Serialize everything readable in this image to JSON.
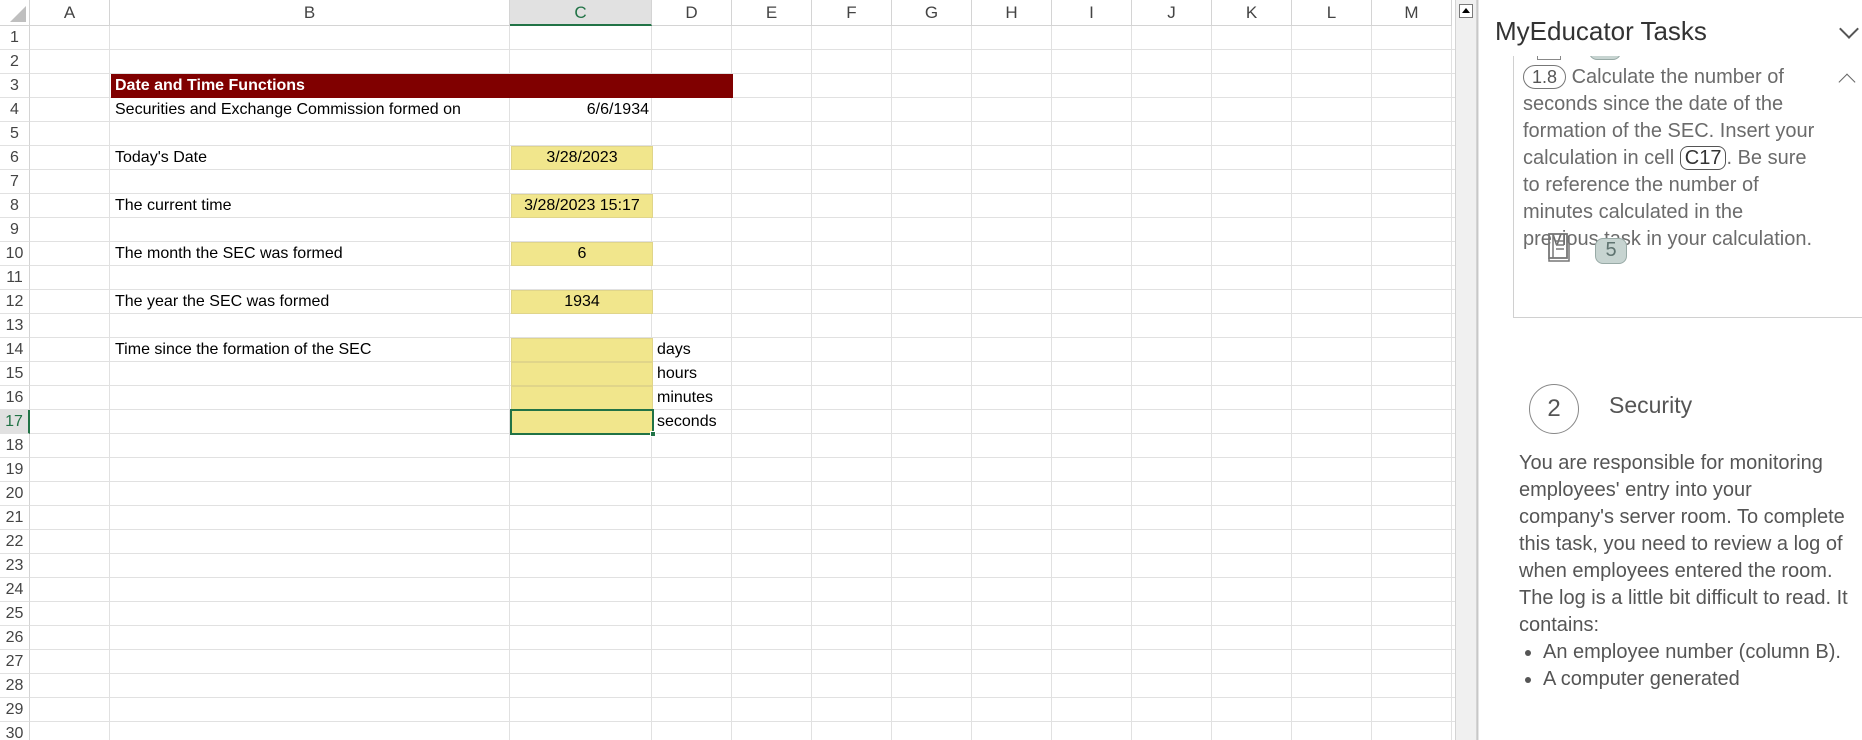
{
  "columns": [
    "A",
    "B",
    "C",
    "D",
    "E",
    "F",
    "G",
    "H",
    "I",
    "J",
    "K",
    "L",
    "M"
  ],
  "selected_column": "C",
  "rows": [
    "1",
    "2",
    "3",
    "4",
    "5",
    "6",
    "7",
    "8",
    "9",
    "10",
    "11",
    "12",
    "13",
    "14",
    "15",
    "16",
    "17",
    "18",
    "19",
    "20",
    "21",
    "22",
    "23",
    "24",
    "25",
    "26",
    "27",
    "28",
    "29",
    "30"
  ],
  "selected_row": "17",
  "sheet": {
    "title": "Date and Time Functions",
    "r4": {
      "label": "Securities and Exchange Commission formed on",
      "value": "6/6/1934"
    },
    "r6": {
      "label": "Today's Date",
      "value": "3/28/2023"
    },
    "r8": {
      "label": "The current time",
      "value": "3/28/2023 15:17"
    },
    "r10": {
      "label": "The month the SEC was formed",
      "value": "6"
    },
    "r12": {
      "label": "The year the SEC was formed",
      "value": "1934"
    },
    "r14": {
      "label": "Time since the formation of the SEC",
      "unit": "days"
    },
    "r15": {
      "unit": "hours"
    },
    "r16": {
      "unit": "minutes"
    },
    "r17": {
      "unit": "seconds"
    }
  },
  "pane": {
    "title": "MyEducator Tasks",
    "task": {
      "number": "1.8",
      "text_before": "Calculate the number of seconds since the date of the formation of the SEC. Insert your calculation in cell",
      "cell_ref": "C17",
      "text_after": ". Be sure to reference the number of minutes calculated in the previous task in your calculation.",
      "resource_count": "5"
    },
    "section": {
      "number": "2",
      "title": "Security",
      "body": "You are responsible for monitoring employees' entry into your company's server room. To complete this task, you need to review a log of when employees entered the room. The log is a little bit difficult to read. It contains:",
      "bullets": [
        "An employee number (column B).",
        "A computer generated"
      ]
    }
  },
  "colors": {
    "title_bar": "#800000",
    "input_fill": "#f1e68c",
    "selection": "#217346"
  }
}
